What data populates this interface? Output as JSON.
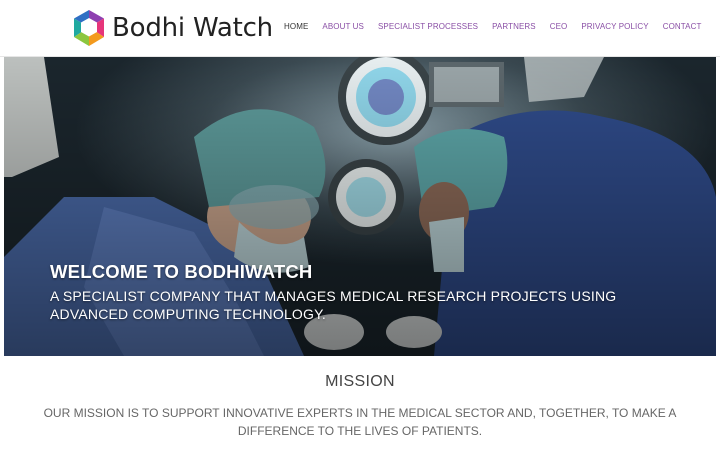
{
  "brand": {
    "name": "Bodhi Watch",
    "logo_icon": "hexagon-logo-icon"
  },
  "nav": {
    "items": [
      {
        "label": "HOME",
        "active": true
      },
      {
        "label": "ABOUT US",
        "active": false
      },
      {
        "label": "SPECIALIST PROCESSES",
        "active": false
      },
      {
        "label": "PARTNERS",
        "active": false
      },
      {
        "label": "CEO",
        "active": false
      },
      {
        "label": "PRIVACY POLICY",
        "active": false
      },
      {
        "label": "CONTACT",
        "active": false
      }
    ]
  },
  "hero": {
    "title": "WELCOME TO BODHIWATCH",
    "subtitle": "A SPECIALIST COMPANY THAT MANAGES MEDICAL RESEARCH PROJECTS USING ADVANCED COMPUTING TECHNOLOGY."
  },
  "mission": {
    "title": "MISSION",
    "text": "OUR MISSION IS TO SUPPORT INNOVATIVE EXPERTS IN THE MEDICAL SECTOR AND, TOGETHER, TO MAKE A DIFFERENCE TO THE LIVES OF PATIENTS."
  },
  "colors": {
    "nav_link": "#8a4fa6",
    "nav_active": "#333333",
    "hero_text": "#ffffff",
    "body_text": "#666666"
  }
}
